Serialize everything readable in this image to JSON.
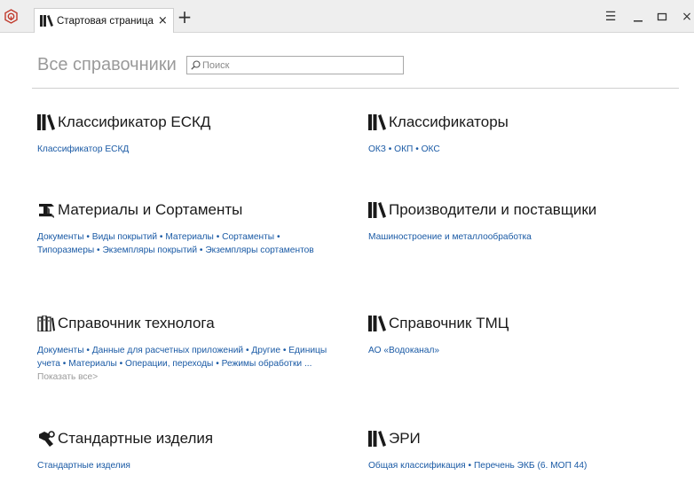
{
  "tab": {
    "title": "Стартовая страница",
    "close": "×"
  },
  "new_tab": "+",
  "window_controls": {
    "menu": "☰",
    "minimize": "—",
    "maximize": "▭",
    "close": "×"
  },
  "heading": "Все справочники",
  "search": {
    "placeholder": "Поиск",
    "value": ""
  },
  "sections": [
    {
      "title": "Классификатор ЕСКД",
      "icon": "books-icon",
      "links": [
        "Классификатор ЕСКД"
      ]
    },
    {
      "title": "Классификаторы",
      "icon": "books-icon",
      "links": [
        "ОКЗ",
        "ОКП",
        "ОКС"
      ]
    },
    {
      "title": "Материалы и Сортаменты",
      "icon": "beam-profile-icon",
      "links": [
        "Документы",
        "Виды покрытий",
        "Материалы",
        "Сортаменты",
        "Типоразмеры",
        "Экземпляры покрытий",
        "Экземпляры сортаментов"
      ]
    },
    {
      "title": "Производители и поставщики",
      "icon": "books-icon",
      "links": [
        "Машиностроение и металлообработка"
      ]
    },
    {
      "title": "Справочник технолога",
      "icon": "tech-binders-icon",
      "links": [
        "Документы",
        "Данные для расчетных приложений",
        "Другие",
        "Единицы учета",
        "Материалы",
        "Операции, переходы",
        "Режимы обработки"
      ],
      "ellipsis": "...",
      "more": "Показать все>"
    },
    {
      "title": "Справочник ТМЦ",
      "icon": "books-icon",
      "links": [
        "АО «Водоканал»"
      ]
    },
    {
      "title": "Стандартные изделия",
      "icon": "bolt-nut-icon",
      "links": [
        "Стандартные изделия"
      ]
    },
    {
      "title": "ЭРИ",
      "icon": "books-icon",
      "links": [
        "Общая классификация",
        "Перечень ЭКБ (6. МОП 44)"
      ]
    }
  ],
  "separator": "•",
  "colors": {
    "link": "#1a5aa5",
    "heading": "#9a9a9a",
    "app_logo": "#c0392b"
  }
}
